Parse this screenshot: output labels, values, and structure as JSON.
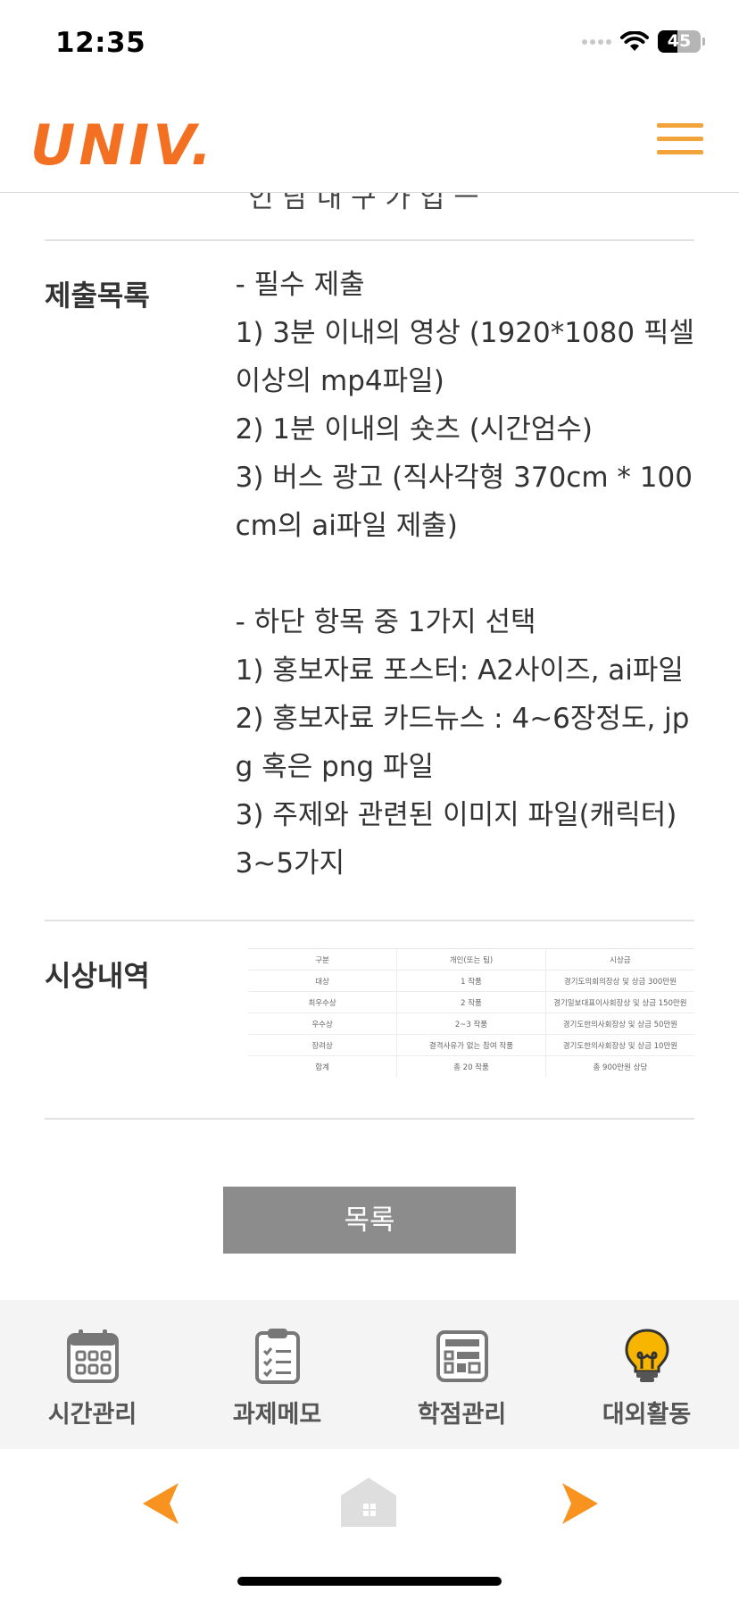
{
  "status": {
    "time": "12:35",
    "battery": "45"
  },
  "header": {
    "logo": "UNIV."
  },
  "content": {
    "cut_text": "인 담 내 구 가 입 ㅡ",
    "submission": {
      "label": "제출목록",
      "lines": [
        "- 필수 제출",
        "1) 3분 이내의 영상 (1920*1080 픽셀",
        "이상의 mp4파일)",
        "2) 1분 이내의 숏츠 (시간엄수)",
        "3) 버스 광고 (직사각형 370cm * 100",
        "cm의 ai파일 제출)",
        "",
        "- 하단 항목 중 1가지 선택",
        "1) 홍보자료 포스터: A2사이즈, ai파일",
        "2) 홍보자료 카드뉴스 : 4~6장정도, jp",
        "g 혹은 png 파일",
        "3) 주제와 관련된 이미지 파일(캐릭터)",
        "3~5가지"
      ]
    },
    "awards": {
      "label": "시상내역",
      "table": [
        [
          "구분",
          "개인(또는 팀)",
          "시상금"
        ],
        [
          "대상",
          "1 작품",
          "경기도의회의장상 및 상금 300만원"
        ],
        [
          "최우수상",
          "2 작품",
          "경기일보대표이사회장상 및 상금 150만원"
        ],
        [
          "우수상",
          "2~3 작품",
          "경기도한의사회장상 및 상금 50만원"
        ],
        [
          "장려상",
          "결격사유가 없는 참여 작품",
          "경기도한의사회장상 및 상금 10만원"
        ],
        [
          "합계",
          "총 20 작품",
          "총 900만원 상당"
        ]
      ]
    },
    "list_button": "목록"
  },
  "tabs": [
    {
      "label": "시간관리",
      "icon": "calendar-icon"
    },
    {
      "label": "과제메모",
      "icon": "clipboard-icon"
    },
    {
      "label": "학점관리",
      "icon": "grade-board-icon"
    },
    {
      "label": "대외활동",
      "icon": "lightbulb-icon"
    }
  ],
  "colors": {
    "brand": "#f36f21",
    "menu": "#f2a33a",
    "button": "#8c8c8c",
    "tabbar": "#f4f4f4"
  }
}
